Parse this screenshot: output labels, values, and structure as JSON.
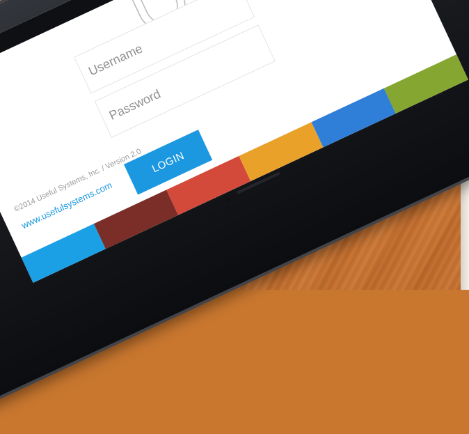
{
  "app": {
    "brand": "Useful"
  },
  "login": {
    "username_placeholder": "Username",
    "password_placeholder": "Password",
    "login_label": "LOGIN"
  },
  "footer": {
    "copyright": "©2014 Useful Systems, Inc. / Version 2.0",
    "website": "www.usefulsystems.com"
  },
  "colors": {
    "accent": "#1b98e0",
    "strip": [
      "#1ba0e6",
      "#7a2e27",
      "#d34a3a",
      "#e9a12a",
      "#2f7fd8",
      "#86a632"
    ]
  },
  "icons": {
    "lock": "lock-icon",
    "home": "home-button-icon"
  }
}
